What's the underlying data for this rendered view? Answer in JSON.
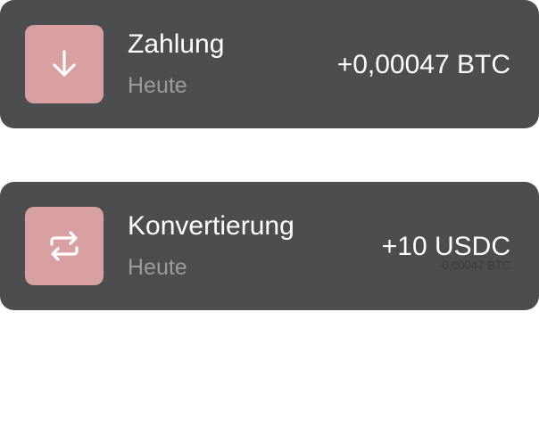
{
  "transactions": [
    {
      "icon": "arrow-down-icon",
      "title": "Zahlung",
      "date": "Heute",
      "amount": "+0,00047 BTC",
      "sub_amount": ""
    },
    {
      "icon": "convert-arrows-icon",
      "title": "Konvertierung",
      "date": "Heute",
      "amount": "+10 USDC",
      "sub_amount": "-0,00047 BTC"
    }
  ],
  "colors": {
    "card_background": "#4c4d4f",
    "icon_tile": "#d8a0a0",
    "primary_text": "#ffffff",
    "secondary_text": "#9a9b9d"
  }
}
